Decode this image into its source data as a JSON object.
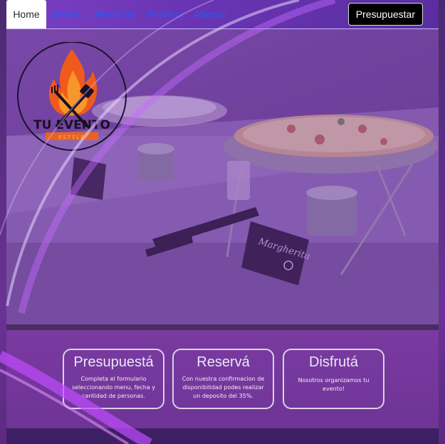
{
  "nav": {
    "items": [
      {
        "label": "Home",
        "active": true
      },
      {
        "label": "Menus"
      },
      {
        "label": "Nosotros"
      },
      {
        "label": "Eventos"
      },
      {
        "label": "Abonar"
      }
    ],
    "cta_label": "Presupuestar"
  },
  "logo": {
    "title": "TU EVENTO",
    "subtitle": "ESTILO"
  },
  "hero": {
    "sign_text": "Margherita"
  },
  "features": [
    {
      "title": "Presupuestá",
      "text": "Completa el formulario seleccionando menu, fecha y cantidad de personas."
    },
    {
      "title": "Reservá",
      "text": "Con nuestra confirmacion de disponibilidad podes realizar un deposito del 35%."
    },
    {
      "title": "Disfrutá",
      "text": "Nosotros organizamos tu evento!"
    }
  ],
  "colors": {
    "accent": "#9b3cff",
    "nav_link": "#1f5bff",
    "cta_bg": "#000000"
  }
}
